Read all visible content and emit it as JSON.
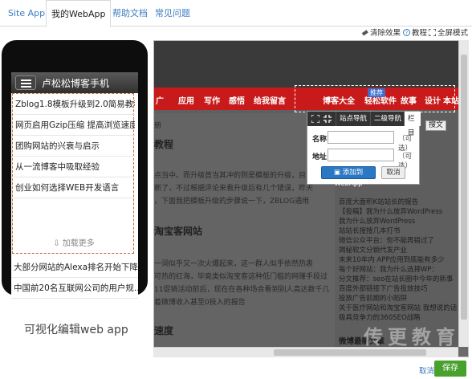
{
  "tabs": [
    {
      "label": "Site App"
    },
    {
      "label": "我的WebApp"
    },
    {
      "label": "帮助文档"
    },
    {
      "label": "常见问题"
    }
  ],
  "toolbar": {
    "clear_label": "清除效果",
    "tutorial_label": "教程",
    "fullscreen_label": "全屏模式"
  },
  "phone": {
    "title": "卢松松博客手机",
    "items": [
      "Zblog1.8模板升级到2.0简易教程",
      "网页启用Gzip压缩 提高浏览速度",
      "团购网站的兴衰与启示",
      "从一流博客中吸取经验",
      "创业如何选择WEB开发语言"
    ],
    "more_label": "加载更多",
    "extra_items": [
      "大部分网站的Alexa排名开始下降",
      "中国前20名互联网公司的用户规..."
    ]
  },
  "caption": "可视化编辑web app",
  "preview": {
    "nav_items": [
      "广",
      "应用",
      "写作",
      "感悟",
      "给我留言",
      "博客大全",
      "轻松软件",
      "故事",
      "设计",
      "本站下载"
    ],
    "badge": "推荐",
    "left_lines": [
      {
        "kind": "small",
        "text": "册"
      },
      {
        "kind": "head",
        "text": "教程"
      },
      {
        "kind": "text",
        "text": "点当中。而升级首当其冲的则是模板的升级，目前已"
      },
      {
        "kind": "text",
        "text": "断了，不过根据评论来看升级后有几个错误，昨天"
      },
      {
        "kind": "text",
        "text": "，下面我把模板升级的步骤说一下，ZBLOG通用"
      },
      {
        "kind": "head",
        "text": "淘宝客网站"
      },
      {
        "kind": "text",
        "text": "一词似乎又一次火爆起来，这一群人似乎依然热衷"
      },
      {
        "kind": "text",
        "text": "可热的红海，毕竟类似淘宝客这种低门槛的网赚手段过"
      },
      {
        "kind": "text",
        "text": "11促销活动前后，现在在各种场合看到别人高达数千几"
      },
      {
        "kind": "text",
        "text": "着微博收入甚至0投入的报告"
      },
      {
        "kind": "head",
        "text": "速度"
      }
    ],
    "right_lines": [
      "百度大面积K站站长的报告",
      "【投稿】我为什么放弃WordPress",
      "我为什么放弃WordPress",
      "站站长搜搜几本打书",
      "微信公众平台：你不能再错过了",
      "揭秘软文分销代发产业",
      "未来10年内 APP应用到底能有多少",
      "每个好网站：我为什么选择WP：",
      "分文推荐：seo在站长圈中今年的新事",
      "百度外部链接下广告投放技巧",
      "投放广告前期的小陷阱",
      "关于医疗网站和淘宝客网站 我想说的话",
      "极具竞争力的360SEO战略"
    ],
    "right_section": "微博最新文章"
  },
  "popup": {
    "tabs": [
      "站点导航",
      "二级导航",
      "栏目"
    ],
    "name_label": "名称",
    "url_label": "地址",
    "hint": "（可选）",
    "add_label": "添加到WebApp",
    "cancel_label": "取消"
  },
  "side_button": "搜文",
  "footer": {
    "cancel_label": "取消",
    "save_label": "保存"
  },
  "watermark": "传更教育",
  "colors": {
    "link": "#3a7cc1",
    "save_green": "#48a12c",
    "nav_red": "#c81a1a",
    "popup_blue": "#2a78c4"
  }
}
